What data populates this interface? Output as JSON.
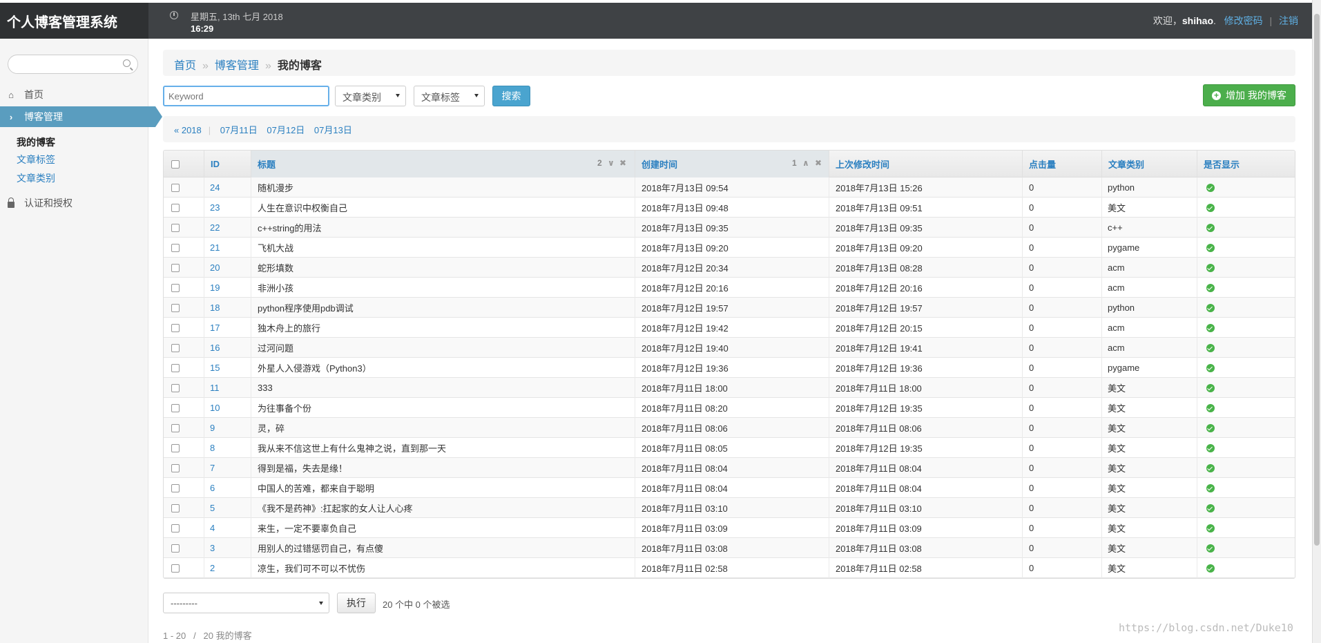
{
  "app": {
    "title": "个人博客管理系统"
  },
  "header": {
    "date_line": "星期五, 13th 七月 2018",
    "time": "16:29",
    "welcome": "欢迎，",
    "user": "shihao",
    "user_suffix": ".",
    "change_password": "修改密码",
    "sep": "|",
    "logout": "注销"
  },
  "sidebar": {
    "home": "首页",
    "blog_admin": "博客管理",
    "sub_items": [
      "我的博客",
      "文章标签",
      "文章类别"
    ],
    "auth": "认证和授权"
  },
  "breadcrumb": {
    "home": "首页",
    "section": "博客管理",
    "current": "我的博客",
    "divider": "»"
  },
  "filters": {
    "keyword_placeholder": "Keyword",
    "category": "文章类别",
    "tag": "文章标签",
    "search": "搜索",
    "add": "增加 我的博客"
  },
  "date_nav": {
    "back": "« 2018",
    "pipe": "|",
    "days": [
      "07月11日",
      "07月12日",
      "07月13日"
    ]
  },
  "table": {
    "headers": {
      "id": "ID",
      "title": "标题",
      "created": "创建时间",
      "modified": "上次修改时间",
      "clicks": "点击量",
      "category": "文章类别",
      "shown": "是否显示"
    },
    "sort_title_priority": "2",
    "sort_created_priority": "1",
    "rows": [
      {
        "id": "24",
        "title": "随机漫步",
        "created": "2018年7月13日 09:54",
        "modified": "2018年7月13日 15:26",
        "clicks": "0",
        "category": "python"
      },
      {
        "id": "23",
        "title": "人生在意识中权衡自己",
        "created": "2018年7月13日 09:48",
        "modified": "2018年7月13日 09:51",
        "clicks": "0",
        "category": "美文"
      },
      {
        "id": "22",
        "title": "c++string的用法",
        "created": "2018年7月13日 09:35",
        "modified": "2018年7月13日 09:35",
        "clicks": "0",
        "category": "c++"
      },
      {
        "id": "21",
        "title": "飞机大战",
        "created": "2018年7月13日 09:20",
        "modified": "2018年7月13日 09:20",
        "clicks": "0",
        "category": "pygame"
      },
      {
        "id": "20",
        "title": "蛇形填数",
        "created": "2018年7月12日 20:34",
        "modified": "2018年7月13日 08:28",
        "clicks": "0",
        "category": "acm"
      },
      {
        "id": "19",
        "title": "非洲小孩",
        "created": "2018年7月12日 20:16",
        "modified": "2018年7月12日 20:16",
        "clicks": "0",
        "category": "acm"
      },
      {
        "id": "18",
        "title": "python程序使用pdb调试",
        "created": "2018年7月12日 19:57",
        "modified": "2018年7月12日 19:57",
        "clicks": "0",
        "category": "python"
      },
      {
        "id": "17",
        "title": "独木舟上的旅行",
        "created": "2018年7月12日 19:42",
        "modified": "2018年7月12日 20:15",
        "clicks": "0",
        "category": "acm"
      },
      {
        "id": "16",
        "title": "过河问题",
        "created": "2018年7月12日 19:40",
        "modified": "2018年7月12日 19:41",
        "clicks": "0",
        "category": "acm"
      },
      {
        "id": "15",
        "title": "外星人入侵游戏（Python3）",
        "created": "2018年7月12日 19:36",
        "modified": "2018年7月12日 19:36",
        "clicks": "0",
        "category": "pygame"
      },
      {
        "id": "11",
        "title": "333",
        "created": "2018年7月11日 18:00",
        "modified": "2018年7月11日 18:00",
        "clicks": "0",
        "category": "美文"
      },
      {
        "id": "10",
        "title": "为往事备个份",
        "created": "2018年7月11日 08:20",
        "modified": "2018年7月12日 19:35",
        "clicks": "0",
        "category": "美文"
      },
      {
        "id": "9",
        "title": "灵，碎",
        "created": "2018年7月11日 08:06",
        "modified": "2018年7月11日 08:06",
        "clicks": "0",
        "category": "美文"
      },
      {
        "id": "8",
        "title": "我从来不信这世上有什么鬼神之说，直到那一天",
        "created": "2018年7月11日 08:05",
        "modified": "2018年7月12日 19:35",
        "clicks": "0",
        "category": "美文"
      },
      {
        "id": "7",
        "title": "得到是福，失去是缘！",
        "created": "2018年7月11日 08:04",
        "modified": "2018年7月11日 08:04",
        "clicks": "0",
        "category": "美文"
      },
      {
        "id": "6",
        "title": "中国人的苦难，都来自于聪明",
        "created": "2018年7月11日 08:04",
        "modified": "2018年7月11日 08:04",
        "clicks": "0",
        "category": "美文"
      },
      {
        "id": "5",
        "title": "《我不是药神》:扛起家的女人让人心疼",
        "created": "2018年7月11日 03:10",
        "modified": "2018年7月11日 03:10",
        "clicks": "0",
        "category": "美文"
      },
      {
        "id": "4",
        "title": "来生，一定不要辜负自己",
        "created": "2018年7月11日 03:09",
        "modified": "2018年7月11日 03:09",
        "clicks": "0",
        "category": "美文"
      },
      {
        "id": "3",
        "title": "用别人的过错惩罚自己，有点傻",
        "created": "2018年7月11日 03:08",
        "modified": "2018年7月11日 03:08",
        "clicks": "0",
        "category": "美文"
      },
      {
        "id": "2",
        "title": "凉生，我们可不可以不忧伤",
        "created": "2018年7月11日 02:58",
        "modified": "2018年7月11日 02:58",
        "clicks": "0",
        "category": "美文"
      }
    ]
  },
  "actions": {
    "select_value": "---------",
    "go": "执行",
    "count": "20 个中 0 个被选"
  },
  "pager": {
    "text": "1 - 20   /   20 我的博客"
  },
  "watermark": "https://blog.csdn.net/Duke10",
  "colors": {
    "topbar": "#3f4245",
    "link": "#2a7fc0",
    "active_nav": "#5a9dbf",
    "add_button": "#4cae4c",
    "search_button": "#4aa4cf"
  }
}
